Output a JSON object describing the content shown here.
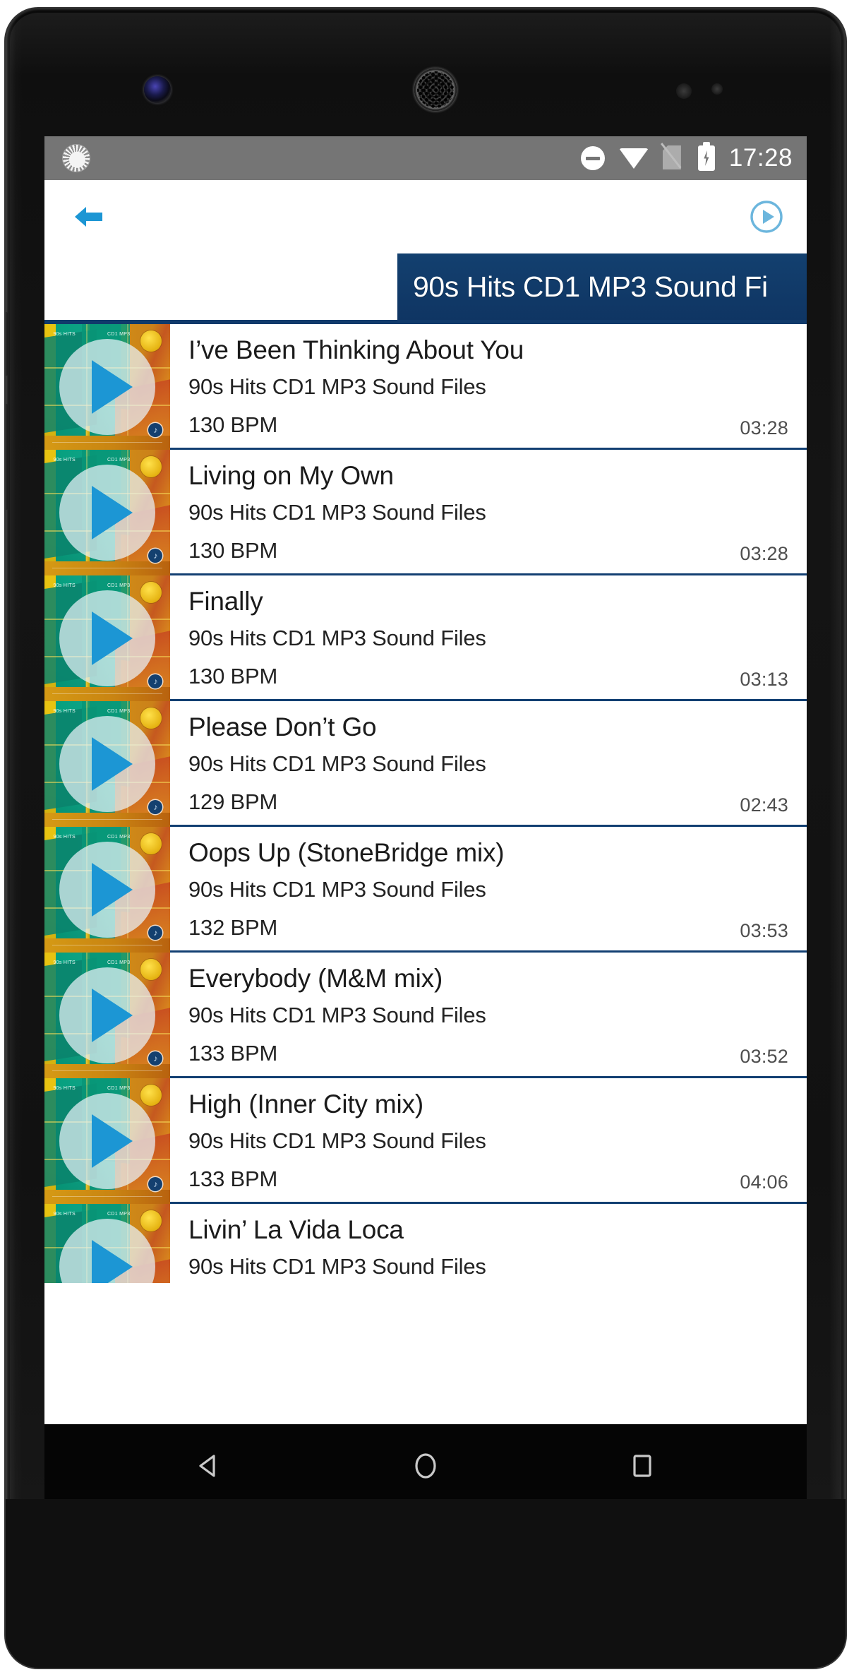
{
  "device": {
    "hardware": {
      "front_camera": "front-camera",
      "earpiece": "earpiece-speaker",
      "sensor_primary": "proximity-sensor",
      "sensor_secondary": "light-sensor"
    }
  },
  "status_bar": {
    "sync_icon": "sync-spinner-icon",
    "icons": [
      {
        "name": "do-not-disturb-icon",
        "label": "Do Not Disturb"
      },
      {
        "name": "wifi-icon",
        "label": "Wi-Fi"
      },
      {
        "name": "no-sim-icon",
        "label": "No SIM"
      },
      {
        "name": "battery-charging-icon",
        "label": "Battery charging"
      }
    ],
    "time": "17:28",
    "background_color": "#757575"
  },
  "app_bar": {
    "back_icon": "back-arrow-icon",
    "play_icon": "play-circle-icon",
    "accent_color": "#1c96d4",
    "play_accent_color": "#6cb6dd"
  },
  "title_banner": {
    "text": "90s Hits CD1 MP3 Sound Fi",
    "background_color": "#113a6b",
    "text_color": "#ffffff"
  },
  "album": {
    "name": "90s Hits CD1 MP3 Sound Files",
    "art_label_left": "90s HITS",
    "art_label_right": "CD1 MP3",
    "art_badge_text": "90 HITS",
    "art_logo": "music-note-logo"
  },
  "list": {
    "divider_color": "#123f72",
    "thumbnail_icon": "album-art-thumbnail",
    "overlay_icon": "play-triangle-overlay",
    "tracks": [
      {
        "title": "I’ve Been Thinking About You",
        "album": "90s Hits CD1 MP3 Sound Files",
        "bpm": "130 BPM",
        "duration": "03:28"
      },
      {
        "title": "Living on My Own",
        "album": "90s Hits CD1 MP3 Sound Files",
        "bpm": "130 BPM",
        "duration": "03:28"
      },
      {
        "title": "Finally",
        "album": "90s Hits CD1 MP3 Sound Files",
        "bpm": "130 BPM",
        "duration": "03:13"
      },
      {
        "title": "Please Don’t Go",
        "album": "90s Hits CD1 MP3 Sound Files",
        "bpm": "129 BPM",
        "duration": "02:43"
      },
      {
        "title": "Oops Up (StoneBridge mix)",
        "album": "90s Hits CD1 MP3 Sound Files",
        "bpm": "132 BPM",
        "duration": "03:53"
      },
      {
        "title": "Everybody (M&M mix)",
        "album": "90s Hits CD1 MP3 Sound Files",
        "bpm": "133 BPM",
        "duration": "03:52"
      },
      {
        "title": "High (Inner City mix)",
        "album": "90s Hits CD1 MP3 Sound Files",
        "bpm": "133 BPM",
        "duration": "04:06"
      },
      {
        "title": "Livin’ La Vida Loca",
        "album": "90s Hits CD1 MP3 Sound Files",
        "bpm": "",
        "duration": ""
      }
    ]
  },
  "nav_bar": {
    "background_color": "#050505",
    "buttons": [
      {
        "name": "nav-back-button",
        "icon": "triangle-back-icon"
      },
      {
        "name": "nav-home-button",
        "icon": "circle-home-icon"
      },
      {
        "name": "nav-recents-button",
        "icon": "square-recents-icon"
      }
    ]
  }
}
